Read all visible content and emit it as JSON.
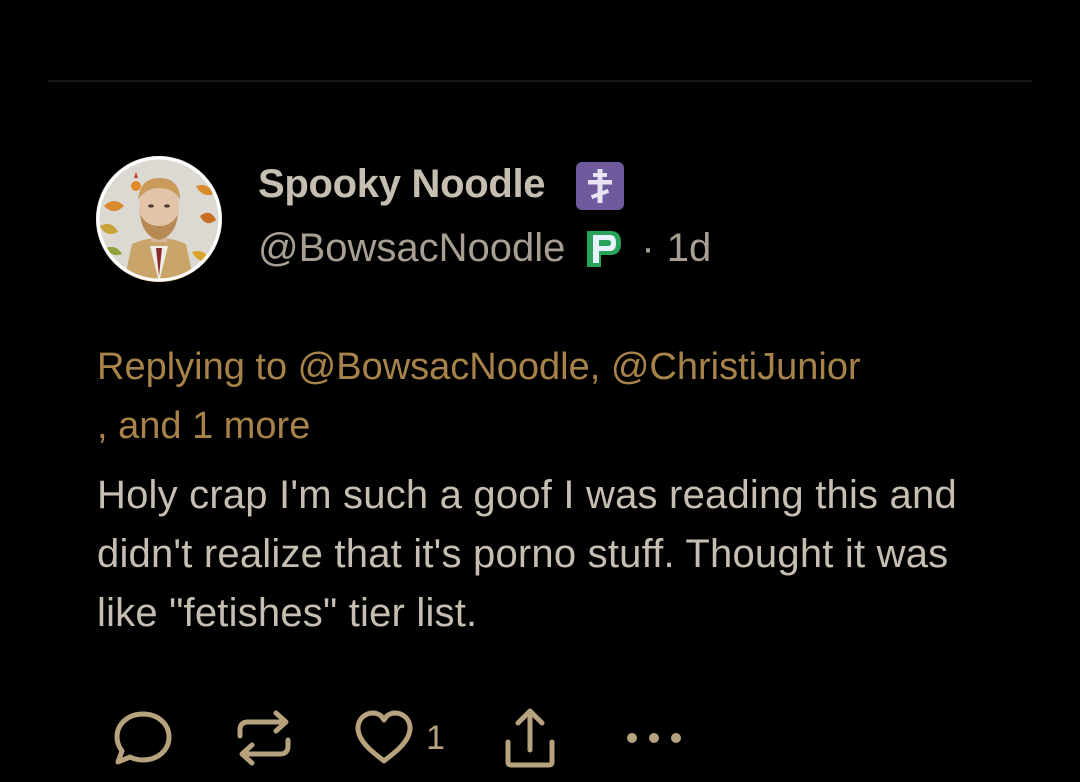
{
  "post": {
    "display_name": "Spooky Noodle",
    "handle": "@BowsacNoodle",
    "separator": "·",
    "time": "1d",
    "replying_prefix": "Replying to ",
    "reply_user_1": "@BowsacNoodle",
    "reply_comma": ", ",
    "reply_user_2": "@ChristiJunior",
    "reply_more": ", and 1 more",
    "body": "Holy crap I'm such a goof I was reading this and didn't realize that it's porno stuff. Thought it was like \"fetishes\" tier list."
  },
  "actions": {
    "like_count": "1",
    "more_label": "•••"
  },
  "icons": {
    "name_badge": "orthodox-cross-icon",
    "handle_badge": "picarto-icon",
    "reply": "comment-bubble-icon",
    "repost": "repost-icon",
    "like": "heart-icon",
    "share": "share-icon",
    "more": "more-dots-icon"
  },
  "colors": {
    "background": "#000000",
    "text": "#c7beb2",
    "muted": "#a89e91",
    "accent": "#a7834a",
    "icon": "#b7a27e",
    "badge_purple": "#6f5a9e",
    "badge_green": "#27a35a"
  }
}
